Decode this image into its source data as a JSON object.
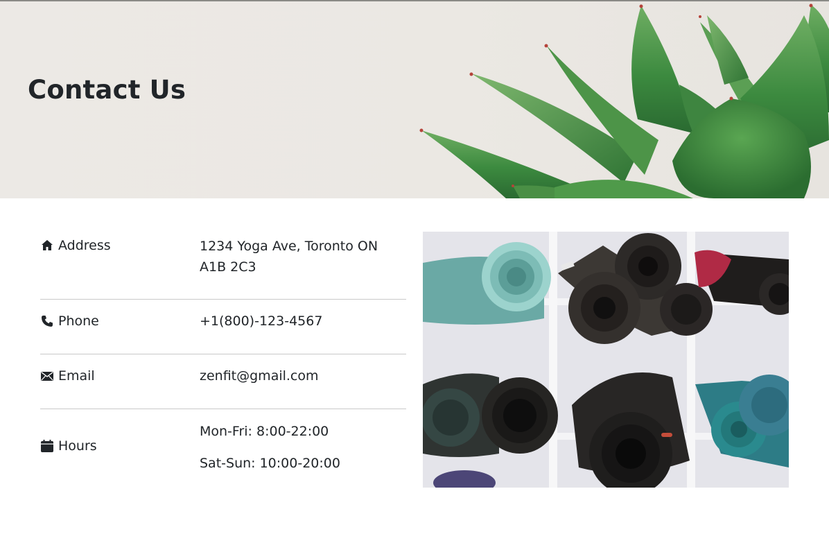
{
  "hero": {
    "title": "Contact Us",
    "image": "succulent-plant-banner"
  },
  "contact": {
    "rows": [
      {
        "icon": "home-icon",
        "label": "Address",
        "value": "1234 Yoga Ave, Toronto ON A1B 2C3"
      },
      {
        "icon": "phone-icon",
        "label": "Phone",
        "value": "+1(800)-123-4567"
      },
      {
        "icon": "envelope-icon",
        "label": "Email",
        "value": "zenfit@gmail.com"
      },
      {
        "icon": "calendar-icon",
        "label": "Hours",
        "values": [
          "Mon-Fri: 8:00-22:00",
          "Sat-Sun: 10:00-20:00"
        ]
      }
    ]
  },
  "photo": {
    "subject": "rolled yoga mats on white shelves"
  },
  "colors": {
    "text": "#212529",
    "divider": "#c9c9c9",
    "plant_green": "#3f8a43",
    "hero_bg": "#ebe8e3"
  }
}
